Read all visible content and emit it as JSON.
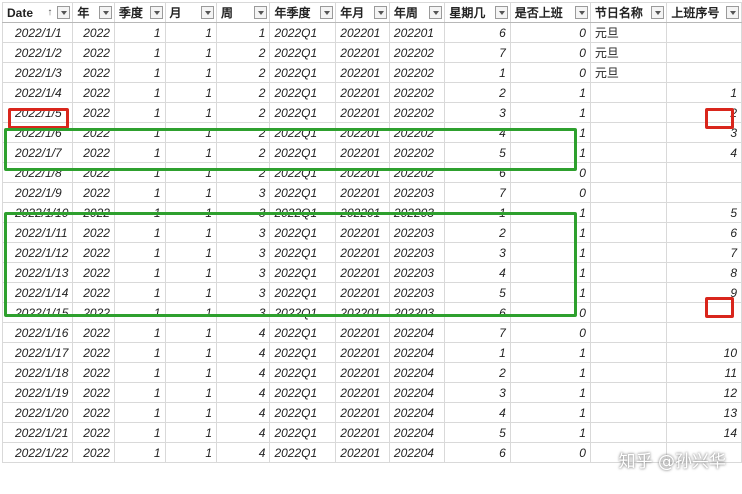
{
  "columns": [
    "Date",
    "年",
    "季度",
    "月",
    "周",
    "年季度",
    "年月",
    "年周",
    "星期几",
    "是否上班",
    "节日名称",
    "上班序号"
  ],
  "rows": [
    {
      "date": "2022/1/1",
      "year": "2022",
      "quarter": "1",
      "month": "1",
      "week": "1",
      "yq": "2022Q1",
      "ym": "202201",
      "yw": "202201",
      "weekday": "6",
      "workday": "0",
      "holiday": "元旦",
      "seq": ""
    },
    {
      "date": "2022/1/2",
      "year": "2022",
      "quarter": "1",
      "month": "1",
      "week": "2",
      "yq": "2022Q1",
      "ym": "202201",
      "yw": "202202",
      "weekday": "7",
      "workday": "0",
      "holiday": "元旦",
      "seq": ""
    },
    {
      "date": "2022/1/3",
      "year": "2022",
      "quarter": "1",
      "month": "1",
      "week": "2",
      "yq": "2022Q1",
      "ym": "202201",
      "yw": "202202",
      "weekday": "1",
      "workday": "0",
      "holiday": "元旦",
      "seq": ""
    },
    {
      "date": "2022/1/4",
      "year": "2022",
      "quarter": "1",
      "month": "1",
      "week": "2",
      "yq": "2022Q1",
      "ym": "202201",
      "yw": "202202",
      "weekday": "2",
      "workday": "1",
      "holiday": "",
      "seq": "1"
    },
    {
      "date": "2022/1/5",
      "year": "2022",
      "quarter": "1",
      "month": "1",
      "week": "2",
      "yq": "2022Q1",
      "ym": "202201",
      "yw": "202202",
      "weekday": "3",
      "workday": "1",
      "holiday": "",
      "seq": "2"
    },
    {
      "date": "2022/1/6",
      "year": "2022",
      "quarter": "1",
      "month": "1",
      "week": "2",
      "yq": "2022Q1",
      "ym": "202201",
      "yw": "202202",
      "weekday": "4",
      "workday": "1",
      "holiday": "",
      "seq": "3"
    },
    {
      "date": "2022/1/7",
      "year": "2022",
      "quarter": "1",
      "month": "1",
      "week": "2",
      "yq": "2022Q1",
      "ym": "202201",
      "yw": "202202",
      "weekday": "5",
      "workday": "1",
      "holiday": "",
      "seq": "4"
    },
    {
      "date": "2022/1/8",
      "year": "2022",
      "quarter": "1",
      "month": "1",
      "week": "2",
      "yq": "2022Q1",
      "ym": "202201",
      "yw": "202202",
      "weekday": "6",
      "workday": "0",
      "holiday": "",
      "seq": ""
    },
    {
      "date": "2022/1/9",
      "year": "2022",
      "quarter": "1",
      "month": "1",
      "week": "3",
      "yq": "2022Q1",
      "ym": "202201",
      "yw": "202203",
      "weekday": "7",
      "workday": "0",
      "holiday": "",
      "seq": ""
    },
    {
      "date": "2022/1/10",
      "year": "2022",
      "quarter": "1",
      "month": "1",
      "week": "3",
      "yq": "2022Q1",
      "ym": "202201",
      "yw": "202203",
      "weekday": "1",
      "workday": "1",
      "holiday": "",
      "seq": "5"
    },
    {
      "date": "2022/1/11",
      "year": "2022",
      "quarter": "1",
      "month": "1",
      "week": "3",
      "yq": "2022Q1",
      "ym": "202201",
      "yw": "202203",
      "weekday": "2",
      "workday": "1",
      "holiday": "",
      "seq": "6"
    },
    {
      "date": "2022/1/12",
      "year": "2022",
      "quarter": "1",
      "month": "1",
      "week": "3",
      "yq": "2022Q1",
      "ym": "202201",
      "yw": "202203",
      "weekday": "3",
      "workday": "1",
      "holiday": "",
      "seq": "7"
    },
    {
      "date": "2022/1/13",
      "year": "2022",
      "quarter": "1",
      "month": "1",
      "week": "3",
      "yq": "2022Q1",
      "ym": "202201",
      "yw": "202203",
      "weekday": "4",
      "workday": "1",
      "holiday": "",
      "seq": "8"
    },
    {
      "date": "2022/1/14",
      "year": "2022",
      "quarter": "1",
      "month": "1",
      "week": "3",
      "yq": "2022Q1",
      "ym": "202201",
      "yw": "202203",
      "weekday": "5",
      "workday": "1",
      "holiday": "",
      "seq": "9"
    },
    {
      "date": "2022/1/15",
      "year": "2022",
      "quarter": "1",
      "month": "1",
      "week": "3",
      "yq": "2022Q1",
      "ym": "202201",
      "yw": "202203",
      "weekday": "6",
      "workday": "0",
      "holiday": "",
      "seq": ""
    },
    {
      "date": "2022/1/16",
      "year": "2022",
      "quarter": "1",
      "month": "1",
      "week": "4",
      "yq": "2022Q1",
      "ym": "202201",
      "yw": "202204",
      "weekday": "7",
      "workday": "0",
      "holiday": "",
      "seq": ""
    },
    {
      "date": "2022/1/17",
      "year": "2022",
      "quarter": "1",
      "month": "1",
      "week": "4",
      "yq": "2022Q1",
      "ym": "202201",
      "yw": "202204",
      "weekday": "1",
      "workday": "1",
      "holiday": "",
      "seq": "10"
    },
    {
      "date": "2022/1/18",
      "year": "2022",
      "quarter": "1",
      "month": "1",
      "week": "4",
      "yq": "2022Q1",
      "ym": "202201",
      "yw": "202204",
      "weekday": "2",
      "workday": "1",
      "holiday": "",
      "seq": "11"
    },
    {
      "date": "2022/1/19",
      "year": "2022",
      "quarter": "1",
      "month": "1",
      "week": "4",
      "yq": "2022Q1",
      "ym": "202201",
      "yw": "202204",
      "weekday": "3",
      "workday": "1",
      "holiday": "",
      "seq": "12"
    },
    {
      "date": "2022/1/20",
      "year": "2022",
      "quarter": "1",
      "month": "1",
      "week": "4",
      "yq": "2022Q1",
      "ym": "202201",
      "yw": "202204",
      "weekday": "4",
      "workday": "1",
      "holiday": "",
      "seq": "13"
    },
    {
      "date": "2022/1/21",
      "year": "2022",
      "quarter": "1",
      "month": "1",
      "week": "4",
      "yq": "2022Q1",
      "ym": "202201",
      "yw": "202204",
      "weekday": "5",
      "workday": "1",
      "holiday": "",
      "seq": "14"
    },
    {
      "date": "2022/1/22",
      "year": "2022",
      "quarter": "1",
      "month": "1",
      "week": "4",
      "yq": "2022Q1",
      "ym": "202201",
      "yw": "202204",
      "weekday": "6",
      "workday": "0",
      "holiday": "",
      "seq": ""
    }
  ],
  "highlights": {
    "red_color": "#d9261c",
    "green_color": "#2ea02e"
  },
  "watermark": "知乎 @孙兴华"
}
